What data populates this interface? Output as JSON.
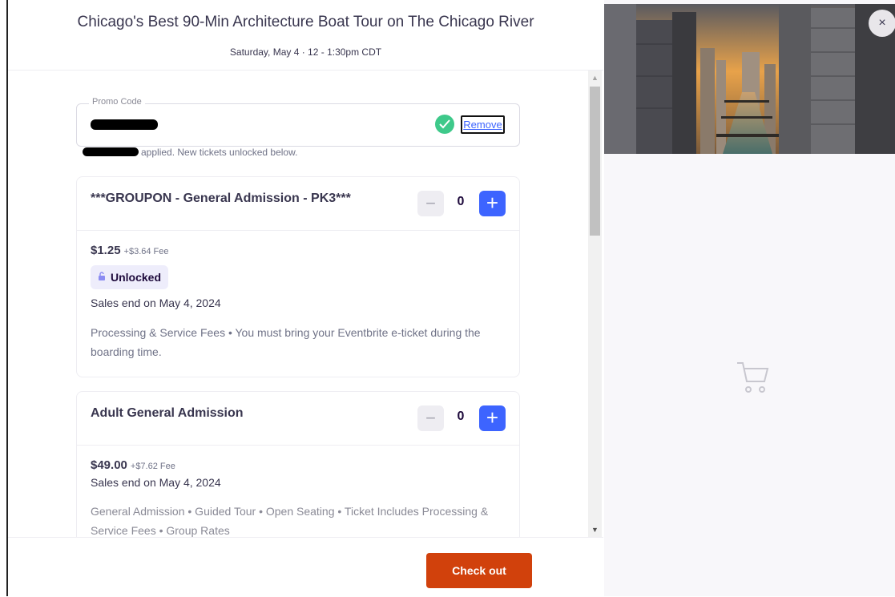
{
  "header": {
    "event_title": "Chicago's Best 90-Min Architecture Boat Tour on The Chicago River",
    "event_date": "Saturday, May 4 · 12 - 1:30pm CDT"
  },
  "promo": {
    "legend": "Promo Code",
    "remove_label": "Remove",
    "applied_text": "applied. New tickets unlocked below."
  },
  "tickets": [
    {
      "name": "***GROUPON - General Admission - PK3***",
      "quantity": "0",
      "price": "$1.25",
      "fee": "+$3.64 Fee",
      "badge": "Unlocked",
      "sales_end": "Sales end on May 4, 2024",
      "description": "Processing & Service Fees • You must bring your Eventbrite e-ticket during the boarding time."
    },
    {
      "name": "Adult General Admission",
      "quantity": "0",
      "price": "$49.00",
      "fee": "+$7.62 Fee",
      "sales_end": "Sales end on May 4, 2024",
      "description": "General Admission • Guided Tour • Open Seating • Ticket Includes Processing & Service Fees • Group Rates"
    }
  ],
  "qty_controls": {
    "minus": "−",
    "plus": "+"
  },
  "footer": {
    "checkout_label": "Check out"
  },
  "close_label": "×",
  "colors": {
    "primary_blue": "#3d64ff",
    "checkout_orange": "#d1410c",
    "success_green": "#3ec98a",
    "badge_bg": "#eeedfb"
  }
}
